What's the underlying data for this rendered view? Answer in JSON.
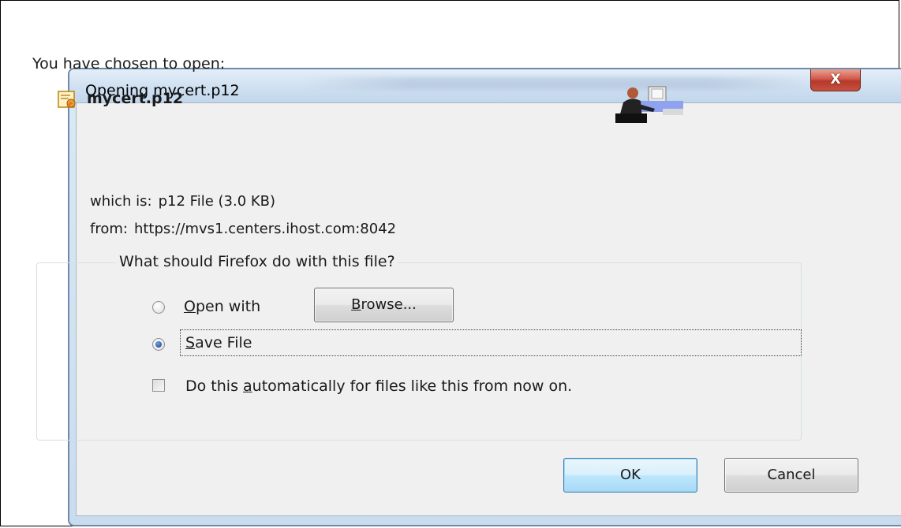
{
  "dialog": {
    "title": "Opening mycert.p12",
    "close_label": "X"
  },
  "intro": "You have chosen to open:",
  "file": {
    "name": "mycert.p12",
    "which_label": "which is:",
    "which_value": "p12 File (3.0 KB)",
    "from_label": "from:",
    "from_value": "https://mvs1.centers.ihost.com:8042"
  },
  "group": {
    "legend": "What should Firefox do with this file?",
    "open_with": {
      "mn": "O",
      "rest": "pen with",
      "selected": false
    },
    "browse": {
      "mn": "B",
      "rest": "rowse..."
    },
    "save_file": {
      "mn": "S",
      "rest": "ave File",
      "selected": true
    },
    "auto": {
      "pre": "Do this ",
      "mn": "a",
      "rest": "utomatically for files like this from now on.",
      "checked": false
    }
  },
  "buttons": {
    "ok": "OK",
    "cancel": "Cancel"
  },
  "icons": {
    "file": "certificate-file-icon",
    "person": "person-at-computer-icon"
  }
}
